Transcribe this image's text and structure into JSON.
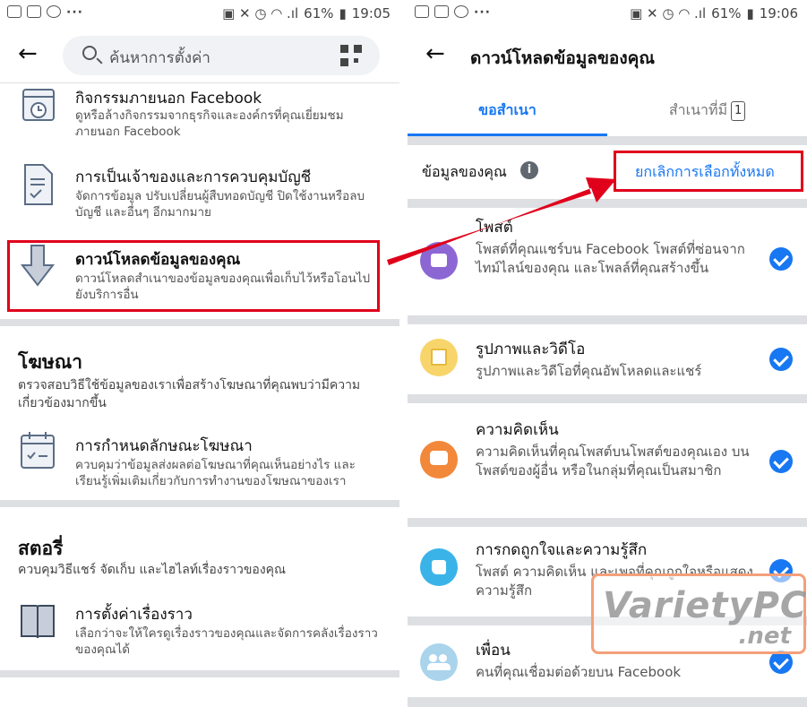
{
  "left": {
    "status": {
      "battery": "61%",
      "time": "19:05"
    },
    "search_placeholder": "ค้นหาการตั้งค่า",
    "items_top": [
      {
        "title": "กิจกรรมภายนอก Facebook",
        "desc": "ดูหรือล้างกิจกรรมจากธุรกิจและองค์กรที่คุณเยี่ยมชมภายนอก Facebook"
      },
      {
        "title": "การเป็นเจ้าของและการควบคุมบัญชี",
        "desc": "จัดการข้อมูล ปรับเปลี่ยนผู้สืบทอดบัญชี ปิดใช้งานหรือลบบัญชี และอื่นๆ อีกมากมาย"
      },
      {
        "title": "ดาวน์โหลดข้อมูลของคุณ",
        "desc": "ดาวน์โหลดสำเนาของข้อมูลของคุณเพื่อเก็บไว้หรือโอนไปยังบริการอื่น"
      }
    ],
    "ads": {
      "heading": "โฆษณา",
      "desc": "ตรวจสอบวิธีใช้ข้อมูลของเราเพื่อสร้างโฆษณาที่คุณพบว่ามีความเกี่ยวข้องมากขึ้น",
      "item": {
        "title": "การกำหนดลักษณะโฆษณา",
        "desc": "ควบคุมว่าข้อมูลส่งผลต่อโฆษณาที่คุณเห็นอย่างไร และเรียนรู้เพิ่มเติมเกี่ยวกับการทำงานของโฆษณาของเรา"
      }
    },
    "stories": {
      "heading": "สตอรี่",
      "desc": "ควบคุมวิธีแชร์ จัดเก็บ และไฮไลท์เรื่องราวของคุณ",
      "item": {
        "title": "การตั้งค่าเรื่องราว",
        "desc": "เลือกว่าจะให้ใครดูเรื่องราวของคุณและจัดการคลังเรื่องราวของคุณได้"
      }
    }
  },
  "right": {
    "status": {
      "battery": "61%",
      "time": "19:06"
    },
    "header_title": "ดาวน์โหลดข้อมูลของคุณ",
    "tabs": [
      {
        "label": "ขอสำเนา"
      },
      {
        "label": "สำเนาที่มี",
        "badge": "1"
      }
    ],
    "your_info_label": "ข้อมูลของคุณ",
    "deselect_all": "ยกเลิกการเลือกทั้งหมด",
    "categories": [
      {
        "title": "โพสต์",
        "desc": "โพสต์ที่คุณแชร์บน Facebook โพสต์ที่ซ่อนจากไทม์ไลน์ของคุณ และโพลล์ที่คุณสร้างขึ้น",
        "color": "#8c67d3",
        "icon": "post-icon"
      },
      {
        "title": "รูปภาพและวิดีโอ",
        "desc": "รูปภาพและวิดีโอที่คุณอัพโหลดและแชร์",
        "color": "#f7d56b",
        "icon": "photo-icon"
      },
      {
        "title": "ความคิดเห็น",
        "desc": "ความคิดเห็นที่คุณโพสต์บนโพสต์ของคุณเอง บนโพสต์ของผู้อื่น หรือในกลุ่มที่คุณเป็นสมาชิก",
        "color": "#f2883a",
        "icon": "comment-icon"
      },
      {
        "title": "การกดถูกใจและความรู้สึก",
        "desc": "โพสต์ ความคิดเห็น และเพจที่คุณถูกใจหรือแสดงความรู้สึก",
        "color": "#3ab4e8",
        "icon": "like-icon"
      },
      {
        "title": "เพื่อน",
        "desc": "คนที่คุณเชื่อมต่อด้วยบน Facebook",
        "color": "#a9d4ec",
        "icon": "friends-icon"
      }
    ],
    "watermark": {
      "main": "VarietyPC",
      "sub": ".net"
    }
  }
}
